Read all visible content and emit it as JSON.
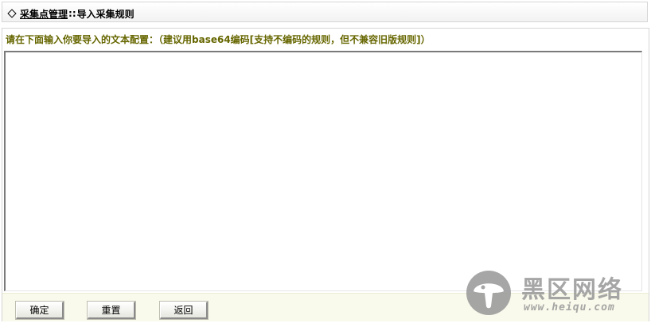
{
  "breadcrumb": {
    "section": "采集点管理",
    "separator": "::",
    "current": "导入采集规则"
  },
  "form": {
    "instruction": "请在下面输入你要导入的文本配置：（建议用base64编码[支持不编码的规则，但不兼容旧版规则]）",
    "textarea_value": ""
  },
  "buttons": {
    "confirm": "确定",
    "reset": "重置",
    "back": "返回"
  },
  "watermark": {
    "title": "黑区网络",
    "url": "www.heiqu.com"
  },
  "colors": {
    "instruction": "#666600",
    "footer_bg": "#f9f9ec",
    "border": "#d6d6d6"
  },
  "icons": {
    "breadcrumb_marker": "diamond-icon",
    "watermark_logo": "mushroom-logo-icon"
  }
}
